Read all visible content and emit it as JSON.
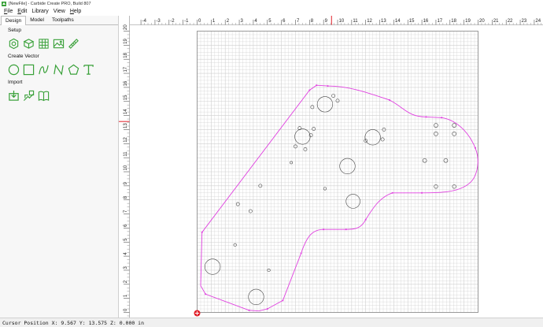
{
  "window": {
    "title": "[NewFile] - Carbide Create PRO, Build 807"
  },
  "menu": {
    "items": [
      {
        "underline": "F",
        "rest": "ile"
      },
      {
        "underline": "E",
        "rest": "dit"
      },
      {
        "underline": "",
        "rest": "Library"
      },
      {
        "underline": "",
        "rest": "View"
      },
      {
        "underline": "H",
        "rest": "elp"
      }
    ]
  },
  "panel": {
    "tabs": [
      {
        "label": "Design",
        "active": true
      },
      {
        "label": "Model",
        "active": false
      },
      {
        "label": "Toolpaths",
        "active": false
      }
    ],
    "sections": {
      "setup": "Setup",
      "create_vector": "Create Vector",
      "import": "Import"
    },
    "setup_icons": [
      "job-setup-icon",
      "stock-setup-icon",
      "grid-icon",
      "image-icon",
      "measure-icon"
    ],
    "vector_icons": [
      "circle-icon",
      "rectangle-icon",
      "curve-icon",
      "polyline-icon",
      "polygon-icon",
      "text-icon"
    ],
    "import_icons": [
      "import-file-icon",
      "import-image-icon",
      "library-icon"
    ],
    "accent": "#3aa13a"
  },
  "ruler": {
    "x_labels": [
      "-4",
      "-3",
      "-2",
      "-1",
      "0",
      "1",
      "2",
      "3",
      "4",
      "5",
      "6",
      "7",
      "8",
      "9",
      "10",
      "11",
      "12",
      "13",
      "14",
      "15",
      "16",
      "17",
      "18",
      "19",
      "20",
      "21",
      "22",
      "23",
      "24"
    ],
    "y_labels": [
      "20",
      "19",
      "18",
      "17",
      "16",
      "15",
      "14",
      "13",
      "12",
      "11",
      "10",
      "9",
      "8",
      "7",
      "6",
      "5",
      "4",
      "3",
      "2",
      "1",
      "0"
    ],
    "cursor_x": 9.567,
    "cursor_y": 13.575,
    "marker_color": "#e0202a"
  },
  "drawing": {
    "outline_color": "#e040e0",
    "grid_color": "#cfcfcf",
    "feature_color": "#444444"
  },
  "status": {
    "cursor_position": "Cursor Position X: 9.567 Y: 13.575 Z: 0.000 in"
  }
}
